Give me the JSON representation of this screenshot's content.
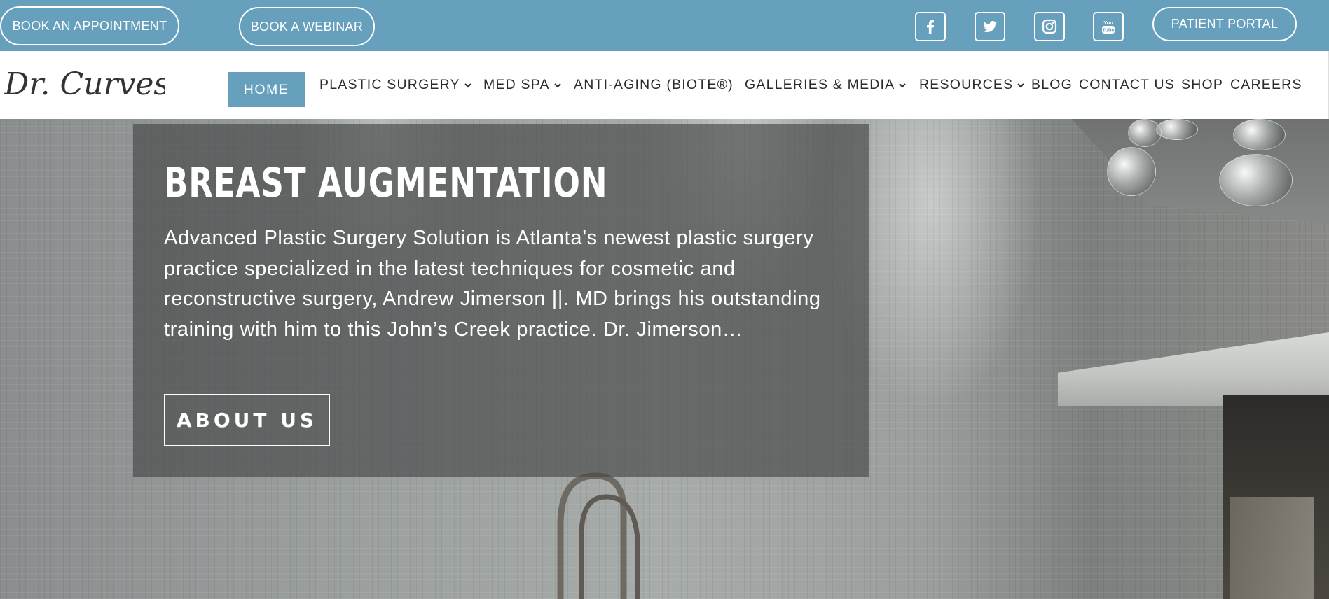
{
  "topbar": {
    "book_appointment": "BOOK AN APPOINTMENT",
    "book_webinar": "BOOK A WEBINAR",
    "patient_portal": "PATIENT PORTAL",
    "social_icons": [
      "facebook-icon",
      "twitter-icon",
      "instagram-icon",
      "youtube-icon"
    ],
    "bg_color": "#66a0bd"
  },
  "logo": {
    "text": "Dr. Curves"
  },
  "nav": {
    "items": [
      {
        "label": "HOME",
        "active": true,
        "has_dropdown": false
      },
      {
        "label": "PLASTIC SURGERY",
        "has_dropdown": true
      },
      {
        "label": "MED SPA",
        "has_dropdown": true
      },
      {
        "label": "ANTI-AGING (BIOTE®)",
        "has_dropdown": false
      },
      {
        "label": "GALLERIES & MEDIA",
        "has_dropdown": true
      },
      {
        "label": "RESOURCES",
        "has_dropdown": true
      },
      {
        "label": "BLOG",
        "has_dropdown": false
      },
      {
        "label": "CONTACT US",
        "has_dropdown": false
      },
      {
        "label": "SHOP",
        "has_dropdown": false
      },
      {
        "label": "CAREERS",
        "has_dropdown": false
      }
    ],
    "accent_color": "#66a0bd"
  },
  "hero": {
    "title": "BREAST AUGMENTATION",
    "text": "Advanced Plastic Surgery Solution is Atlanta’s newest plastic surgery practice specialized in the latest techniques for cosmetic and reconstructive surgery, Andrew Jimerson ||. MD brings his outstanding training with him to this John’s Creek practice. Dr. Jimerson…",
    "button": "ABOUT US"
  }
}
